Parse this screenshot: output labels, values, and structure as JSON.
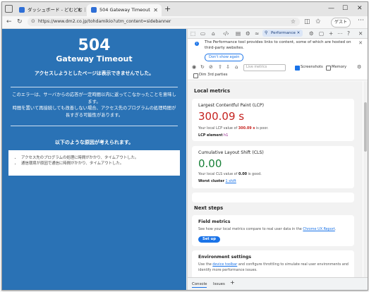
{
  "tabs": [
    {
      "label": "ダッシュボード - どむどむ｜株式会社...",
      "active": false
    },
    {
      "label": "504 Gateway Timeout",
      "active": true
    }
  ],
  "window_controls": {
    "minimize": "—",
    "maximize": "☐",
    "close": "✕"
  },
  "address": {
    "url": "https://www.dm2.co.jp/tohdamikio?utm_content=sidebanner",
    "guest_label": "ゲスト"
  },
  "page": {
    "code": "504",
    "title": "Gateway Timeout",
    "subtitle": "アクセスしようとしたページは表示できませんでした。",
    "desc1": "このエラーは、サーバからの応答が一定時間以内に返ってこなかったことを意味します。",
    "desc2": "時間を置いて再接続しても改善しない場合、アクセス先のプログラムの処理時間が長すぎる可能性があります。",
    "reasons_title": "以下のような原因が考えられます。",
    "reasons": [
      "アクセス先のプログラムの処理に時間がかかり、タイムアウトした。",
      "通信環境が原因で通信に時間がかかり、タイムアウトした。"
    ]
  },
  "devtools": {
    "panel_tab": "Performance",
    "notice_text": "The Performance tool provides links to content, some of which are hosted on third-party websites.",
    "notice_button": "Don't show again",
    "live_metrics_select": "Live metrics",
    "screenshots_label": "Screenshots",
    "memory_label": "Memory",
    "dim_label": "Dim 3rd parties",
    "local_metrics_heading": "Local metrics",
    "lcp": {
      "title": "Largest Contentful Paint (LCP)",
      "value": "300.09 s",
      "desc_pre": "Your local LCP value of ",
      "desc_val": "300.09 s",
      "desc_post": " is poor.",
      "element_label": "LCP element",
      "element_value": "h1"
    },
    "cls": {
      "title": "Cumulative Layout Shift (CLS)",
      "value": "0.00",
      "desc_pre": "Your local CLS value of ",
      "desc_val": "0.00",
      "desc_post": " is good.",
      "worst_label": "Worst cluster",
      "worst_value": "1 shift"
    },
    "next_steps_heading": "Next steps",
    "field": {
      "title": "Field metrics",
      "desc_pre": "See how your local metrics compare to real user data in the ",
      "link": "Chrome UX Report",
      "desc_post": ".",
      "button": "Set up"
    },
    "env": {
      "title": "Environment settings",
      "line1_pre": "Use the ",
      "line1_link": "device toolbar",
      "line1_post": " and configure throttling to simulate real user environments and",
      "line2": "identify more performance issues."
    },
    "drawer": {
      "console": "Console",
      "issues": "Issues",
      "add": "+"
    }
  },
  "colors": {
    "page_bg": "#2a72b5",
    "poor": "#c5221f",
    "good": "#188038",
    "accent": "#1a73e8"
  }
}
